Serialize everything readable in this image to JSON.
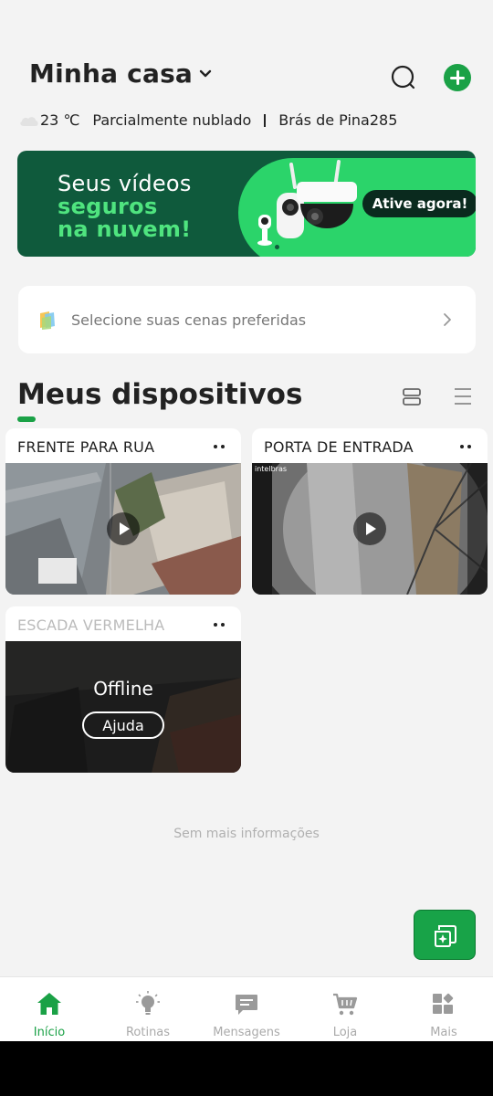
{
  "header": {
    "home_name": "Minha casa",
    "weather": {
      "icon": "cloud-icon",
      "temperature": "23 ℃",
      "condition": "Parcialmente nublado",
      "location": "Brás de Pina285"
    }
  },
  "banner": {
    "line1": "Seus vídeos",
    "line2": "seguros",
    "line3": "na nuvem!",
    "cta": "Ative agora!",
    "colors": {
      "dark": "#0f5a3c",
      "accent": "#2bd46a"
    }
  },
  "scenes": {
    "text": "Selecione suas cenas preferidas"
  },
  "devices": {
    "title": "Meus dispositivos",
    "items": [
      {
        "name": "FRENTE PARA RUA",
        "status": "online"
      },
      {
        "name": "PORTA DE ENTRADA",
        "status": "online",
        "overlay_brand": "intelbras"
      },
      {
        "name": "ESCADA VERMELHA",
        "status": "offline",
        "offline_text": "Offline",
        "help_label": "Ajuda"
      }
    ],
    "no_more": "Sem mais informações"
  },
  "nav": {
    "items": [
      {
        "label": "Início",
        "icon": "home-icon",
        "active": true
      },
      {
        "label": "Rotinas",
        "icon": "lightbulb-icon",
        "active": false
      },
      {
        "label": "Mensagens",
        "icon": "message-icon",
        "active": false
      },
      {
        "label": "Loja",
        "icon": "cart-icon",
        "active": false
      },
      {
        "label": "Mais",
        "icon": "grid-icon",
        "active": false
      }
    ]
  },
  "colors": {
    "accent": "#1aa146",
    "background": "#f3f3f3"
  }
}
